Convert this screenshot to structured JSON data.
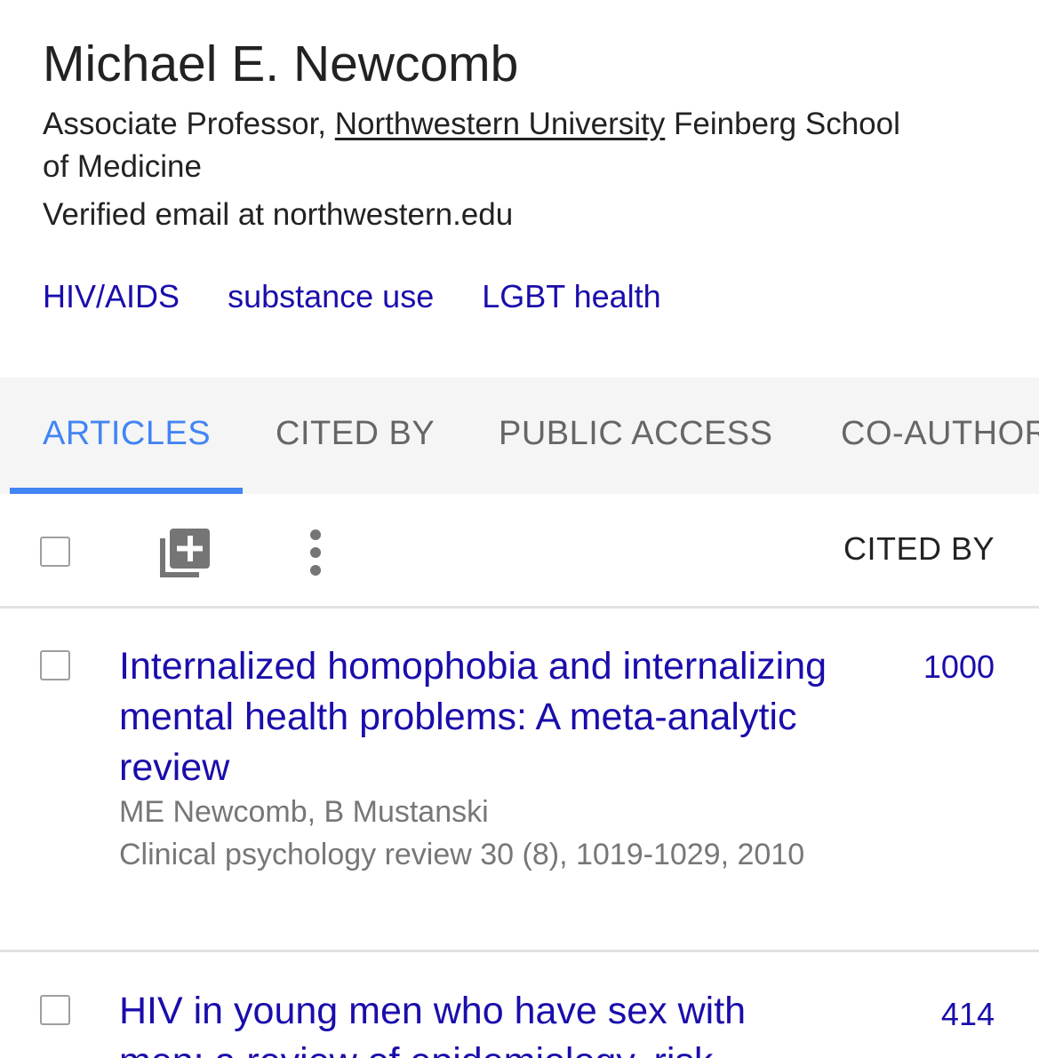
{
  "profile": {
    "name": "Michael E. Newcomb",
    "affiliation_prefix": "Associate Professor, ",
    "affiliation_link": "Northwestern University",
    "affiliation_suffix": " Feinberg School of Medicine",
    "email": "Verified email at northwestern.edu",
    "interests": [
      "HIV/AIDS",
      "substance use",
      "LGBT health"
    ]
  },
  "tabs": [
    {
      "label": "ARTICLES",
      "active": true
    },
    {
      "label": "CITED BY",
      "active": false
    },
    {
      "label": "PUBLIC ACCESS",
      "active": false
    },
    {
      "label": "CO-AUTHORS",
      "active": false
    }
  ],
  "toolbar": {
    "cited_by_header": "CITED BY",
    "add_icon": "add-to-library-icon",
    "more_icon": "more-vert-icon"
  },
  "articles": [
    {
      "title": "Internalized homophobia and internalizing mental health problems: A meta-analytic review",
      "authors": "ME Newcomb, B Mustanski",
      "venue": "Clinical psychology review 30 (8), 1019-1029, 2010",
      "cited_by": "1000"
    },
    {
      "title": "HIV in young men who have sex with men: a review of epidemiology, risk",
      "authors": "",
      "venue": "",
      "cited_by": "414"
    }
  ],
  "colors": {
    "accent": "#4285f4",
    "link": "#1a0dab",
    "meta_text": "#777777",
    "tab_bar_bg": "#f5f5f5"
  }
}
